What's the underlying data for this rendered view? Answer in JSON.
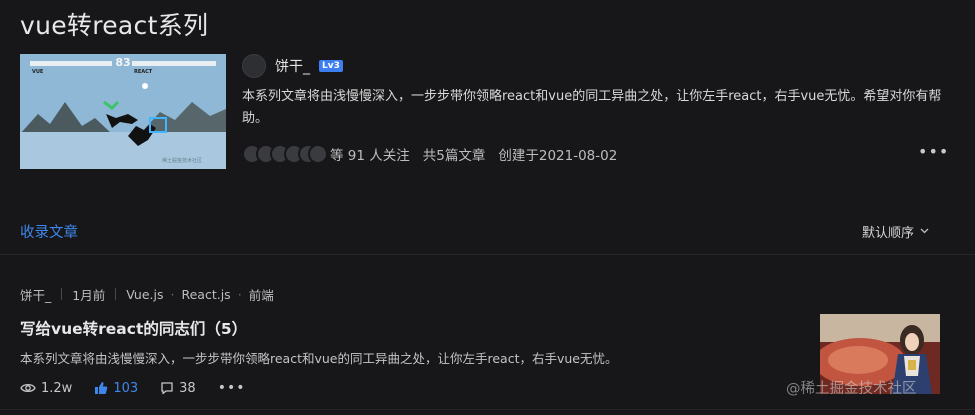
{
  "series": {
    "title": "vue转react系列",
    "author": {
      "name": "饼干_",
      "level": "Lv3"
    },
    "description": "本系列文章将由浅慢慢深入，一步步带你领略react和vue的同工异曲之处，让你左手react，右手vue无忧。希望对你有帮助。",
    "stats": {
      "followers": "等 91 人关注",
      "articles": "共5篇文章",
      "created": "创建于2021-08-02"
    },
    "more": "•••",
    "cover": {
      "score": "83",
      "player1": "VUE",
      "player2": "REACT",
      "watermark": "稀土掘金技术社区"
    }
  },
  "tabs": {
    "active": "收录文章",
    "sort_label": "默认顺序",
    "sort_icon": "chevron-down-icon"
  },
  "article": {
    "author": "饼干_",
    "time": "1月前",
    "tags": [
      "Vue.js",
      "React.js",
      "前端"
    ],
    "title": "写给vue转react的同志们（5）",
    "description": "本系列文章将由浅慢慢深入，一步步带你领略react和vue的同工异曲之处，让你左手react，右手vue无忧。",
    "views": "1.2w",
    "likes": "103",
    "comments": "38",
    "more": "•••"
  },
  "watermark": "@稀土掘金技术社区",
  "colors": {
    "accent": "#3d87ec",
    "background": "#17171a",
    "level_badge": "#3d7ef0"
  }
}
